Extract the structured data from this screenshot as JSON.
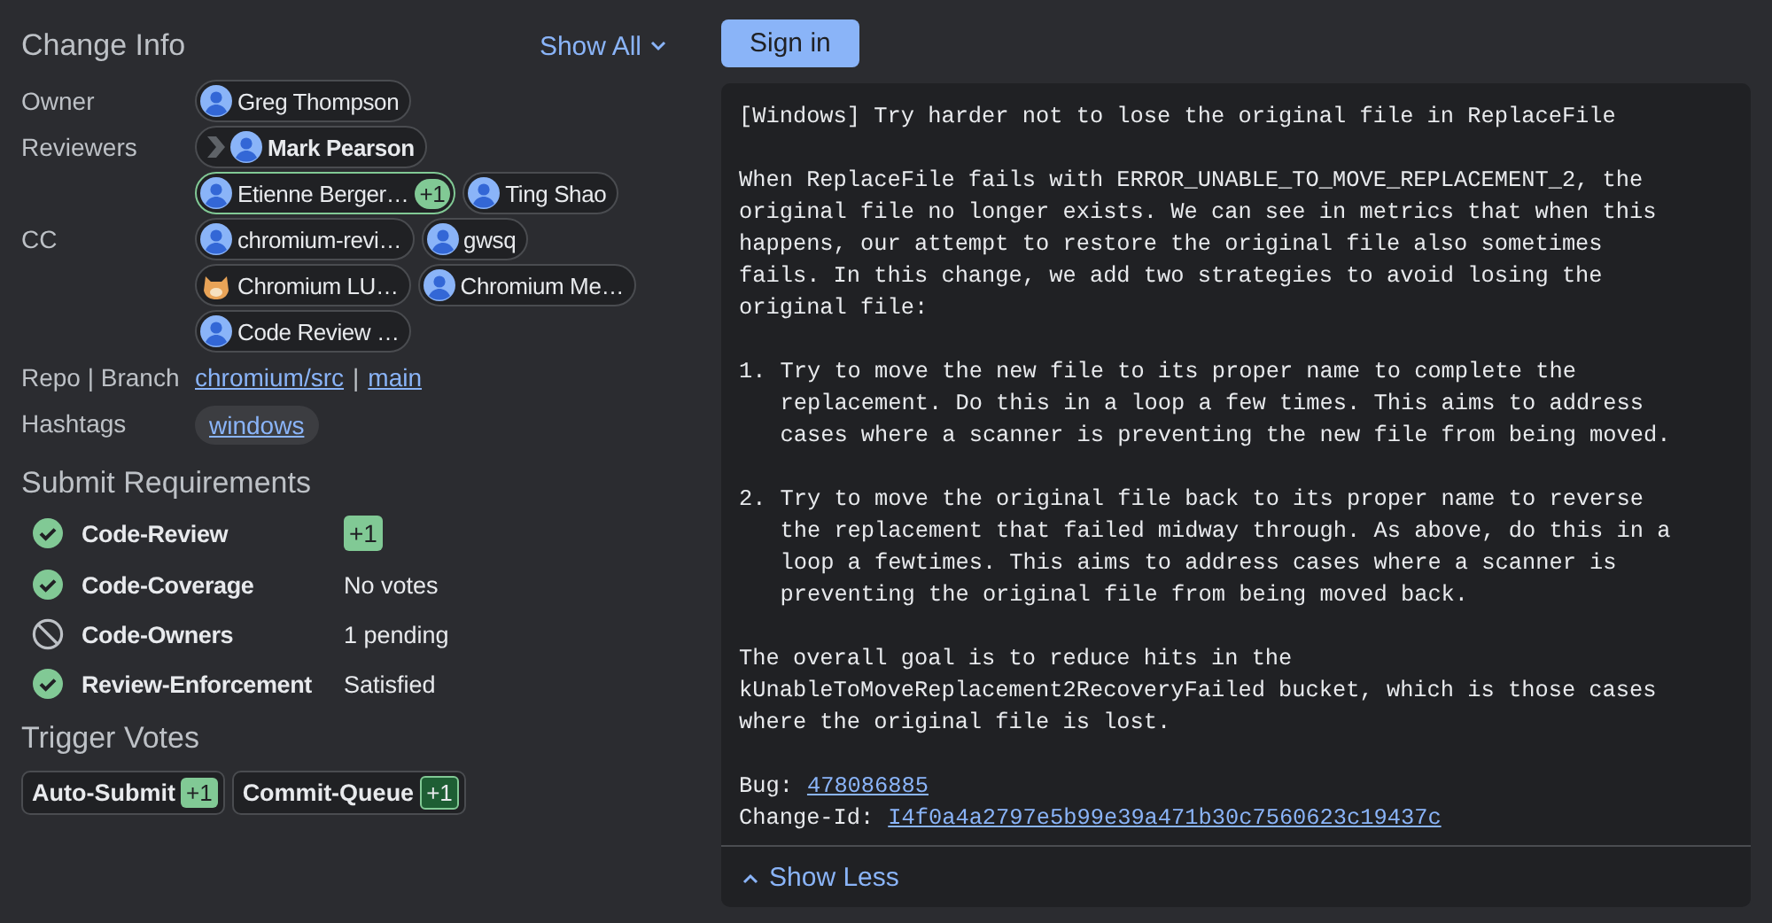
{
  "change_info": {
    "title": "Change Info",
    "show_all": "Show All",
    "fields": [
      {
        "label": "Owner",
        "kind": "people",
        "people": [
          {
            "name": "Greg Thompson",
            "kind": "person",
            "attention": false
          }
        ]
      },
      {
        "label": "Reviewers",
        "kind": "people",
        "people": [
          {
            "name": "Mark Pearson",
            "kind": "person",
            "attention": true
          },
          {
            "name": "Etienne Berger…",
            "kind": "person",
            "attention": false,
            "vote": "+1"
          },
          {
            "name": "Ting Shao",
            "kind": "person",
            "attention": false
          }
        ]
      },
      {
        "label": "CC",
        "kind": "people",
        "people": [
          {
            "name": "chromium-revi…",
            "kind": "person",
            "attention": false
          },
          {
            "name": "gwsq",
            "kind": "person",
            "attention": false
          },
          {
            "name": "Chromium LU…",
            "kind": "bot",
            "attention": false
          },
          {
            "name": "Chromium Me…",
            "kind": "person",
            "attention": false
          },
          {
            "name": "Code Review …",
            "kind": "person",
            "attention": false
          }
        ]
      },
      {
        "label": "Repo | Branch",
        "kind": "links",
        "links": [
          "chromium/src",
          "main"
        ],
        "separator": "|"
      },
      {
        "label": "Hashtags",
        "kind": "tags",
        "tags": [
          "windows"
        ]
      }
    ]
  },
  "submit_requirements": {
    "title": "Submit Requirements",
    "items": [
      {
        "name": "Code-Review",
        "satisfied": true,
        "kind": "vote",
        "value": "+1"
      },
      {
        "name": "Code-Coverage",
        "satisfied": true,
        "kind": "text",
        "value": "No votes"
      },
      {
        "name": "Code-Owners",
        "satisfied": false,
        "kind": "text",
        "value": "1 pending"
      },
      {
        "name": "Review-Enforcement",
        "satisfied": true,
        "kind": "text",
        "value": "Satisfied"
      }
    ]
  },
  "trigger_votes": {
    "title": "Trigger Votes",
    "items": [
      {
        "label": "Auto-Submit",
        "vote": "+1"
      },
      {
        "label": "Commit-Queue",
        "vote": "+1"
      }
    ]
  },
  "sign_in": "Sign in",
  "commit_message": {
    "blocks": [
      {
        "kind": "text",
        "text": "[Windows] Try harder not to lose the original file in ReplaceFile"
      },
      {
        "kind": "text",
        "text": "When ReplaceFile fails with ERROR_UNABLE_TO_MOVE_REPLACEMENT_2, the\noriginal file no longer exists. We can see in metrics that when this\nhappens, our attempt to restore the original file also sometimes\nfails. In this change, we add two strategies to avoid losing the\noriginal file:"
      },
      {
        "kind": "step",
        "number": "1.",
        "text": "Try to move the new file to its proper name to complete the\nreplacement. Do this in a loop a few times. This aims to address\ncases where a scanner is preventing the new file from being moved."
      },
      {
        "kind": "step",
        "number": "2.",
        "text": "Try to move the original file back to its proper name to reverse\nthe replacement that failed midway through. As above, do this in a\nloop a fewtimes. This aims to address cases where a scanner is\npreventing the original file from being moved back."
      },
      {
        "kind": "text",
        "text": "The overall goal is to reduce hits in the\nkUnableToMoveReplacement2RecoveryFailed bucket, which is those cases\nwhere the original file is lost."
      },
      {
        "kind": "footer",
        "lines": [
          {
            "label": "Bug:",
            "link": "478086885"
          },
          {
            "label": "Change-Id:",
            "link": "I4f0a4a2797e5b99e39a471b30c7560623c19437c"
          }
        ]
      }
    ],
    "show_less": "Show Less"
  }
}
